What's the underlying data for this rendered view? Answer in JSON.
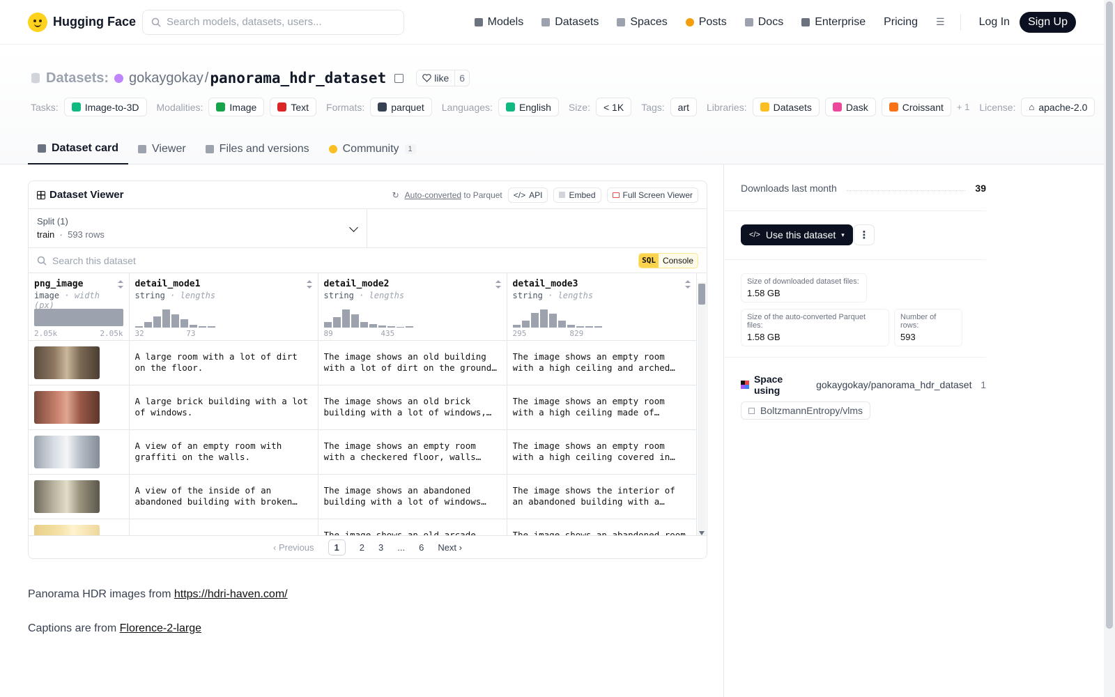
{
  "nav": {
    "brand": "Hugging Face",
    "search_placeholder": "Search models, datasets, users...",
    "links": [
      {
        "label": "Models",
        "icon": "cube-icon",
        "color": "#6b7280"
      },
      {
        "label": "Datasets",
        "icon": "database-icon",
        "color": "#9ca3af"
      },
      {
        "label": "Spaces",
        "icon": "grid-icon",
        "color": "#9ca3af"
      },
      {
        "label": "Posts",
        "icon": "posts-icon",
        "color": "#f59e0b"
      },
      {
        "label": "Docs",
        "icon": "docs-icon",
        "color": "#9ca3af"
      },
      {
        "label": "Enterprise",
        "icon": "enterprise-icon",
        "color": "#6b7280"
      },
      {
        "label": "Pricing",
        "icon": "",
        "color": ""
      }
    ],
    "login": "Log In",
    "signup": "Sign Up"
  },
  "header": {
    "crumb_label": "Datasets:",
    "owner": "gokaygokay",
    "separator": "/",
    "repo": "panorama_hdr_dataset",
    "like_label": "like",
    "like_count": "6",
    "tags": [
      {
        "label": "Tasks:",
        "items": [
          {
            "text": "Image-to-3D",
            "color": "#10b981"
          }
        ]
      },
      {
        "label": "Modalities:",
        "items": [
          {
            "text": "Image",
            "color": "#16a34a"
          },
          {
            "text": "Text",
            "color": "#dc2626"
          }
        ]
      },
      {
        "label": "Formats:",
        "items": [
          {
            "text": "parquet",
            "color": "#374151"
          }
        ]
      },
      {
        "label": "Languages:",
        "items": [
          {
            "text": "English",
            "color": "#10b981"
          }
        ]
      },
      {
        "label": "Size:",
        "items": [
          {
            "text": "< 1K",
            "color": ""
          }
        ]
      },
      {
        "label": "Tags:",
        "items": [
          {
            "text": "art",
            "color": ""
          }
        ]
      },
      {
        "label": "Libraries:",
        "items": [
          {
            "text": "Datasets",
            "color": "#fbbf24"
          },
          {
            "text": "Dask",
            "color": "#ec4899"
          },
          {
            "text": "Croissant",
            "color": "#f97316"
          }
        ]
      }
    ],
    "more_libraries": "+ 1",
    "license_label": "License:",
    "license": "apache-2.0",
    "tabs": [
      {
        "label": "Dataset card",
        "active": true
      },
      {
        "label": "Viewer",
        "active": false
      },
      {
        "label": "Files and versions",
        "active": false
      },
      {
        "label": "Community",
        "active": false,
        "badge": "1"
      }
    ]
  },
  "viewer": {
    "title": "Dataset Viewer",
    "auto_converted": "Auto-converted",
    "to_parquet": "to Parquet",
    "api": "API",
    "embed": "Embed",
    "full_screen": "Full Screen Viewer",
    "split_label": "Split (1)",
    "split_name": "train",
    "split_rows": "593 rows",
    "search_placeholder": "Search this dataset",
    "sql": "SQL",
    "console": "Console",
    "columns": [
      {
        "name": "png_image",
        "type": "image",
        "sub": "width (px)",
        "min": "2.05k",
        "max": "2.05k",
        "hist": []
      },
      {
        "name": "detail_mode1",
        "type": "string",
        "sub": "lengths",
        "min": "32",
        "max": "73",
        "hist": [
          0.05,
          0.3,
          0.6,
          1.0,
          0.7,
          0.45,
          0.12,
          0.06,
          0.04
        ]
      },
      {
        "name": "detail_mode2",
        "type": "string",
        "sub": "lengths",
        "min": "89",
        "max": "435",
        "hist": [
          0.3,
          0.55,
          1.0,
          0.7,
          0.3,
          0.18,
          0.1,
          0.04,
          0.0,
          0.04
        ]
      },
      {
        "name": "detail_mode3",
        "type": "string",
        "sub": "lengths",
        "min": "295",
        "max": "829",
        "hist": [
          0.12,
          0.35,
          0.8,
          1.0,
          0.75,
          0.35,
          0.15,
          0.04,
          0.04,
          0.04
        ]
      }
    ],
    "rows": [
      {
        "thumb": "room-dirt",
        "c1": "A large room with a lot of dirt on the floor.",
        "c2": "The image shows an old building with a lot of dirt on the ground, walls, pillars, and a roof.",
        "c3": "The image shows an empty room with a high ceiling and arched windows. The walls are made of brick."
      },
      {
        "thumb": "brick-building",
        "c1": "A large brick building with a lot of windows.",
        "c2": "The image shows an old brick building with a lot of windows, walls, pillars, and a roof.",
        "c3": "The image shows an empty room with a high ceiling made of corrugated metal sheets."
      },
      {
        "thumb": "graffiti-room",
        "c1": "A view of an empty room with graffiti on the walls.",
        "c2": "The image shows an empty room with a checkered floor, walls adorned with graffiti.",
        "c3": "The image shows an empty room with a high ceiling covered in white fabric draped over."
      },
      {
        "thumb": "abandoned-building",
        "c1": "A view of the inside of an abandoned building with broken windows.",
        "c2": "The image shows an abandoned building with a lot of windows and debris on the floor.",
        "c3": "The image shows the interior of an abandoned building with a circular structure."
      },
      {
        "thumb": "arcade",
        "c1": "",
        "c2": "The image shows an old arcade with a",
        "c3": "The image shows an abandoned room"
      }
    ],
    "pager": {
      "prev": "Previous",
      "pages": [
        "1",
        "2",
        "3",
        "...",
        "6"
      ],
      "next": "Next"
    }
  },
  "description": {
    "line1_text": "Panorama HDR images from ",
    "line1_link": "https://hdri-haven.com/",
    "line2_text": "Captions are from ",
    "line2_link": "Florence-2-large"
  },
  "sidebar": {
    "downloads_label": "Downloads last month",
    "downloads_value": "39",
    "use_button": "Use this dataset",
    "stats": [
      {
        "label": "Size of downloaded dataset files:",
        "value": "1.58 GB"
      },
      {
        "label": "Size of the auto-converted Parquet files:",
        "value": "1.58 GB"
      },
      {
        "label": "Number of rows:",
        "value": "593"
      }
    ],
    "space_using": "Space using",
    "space_path": "gokaygokay/panorama_hdr_dataset",
    "space_count": "1",
    "space_item": "BoltzmannEntropy/vlms"
  }
}
